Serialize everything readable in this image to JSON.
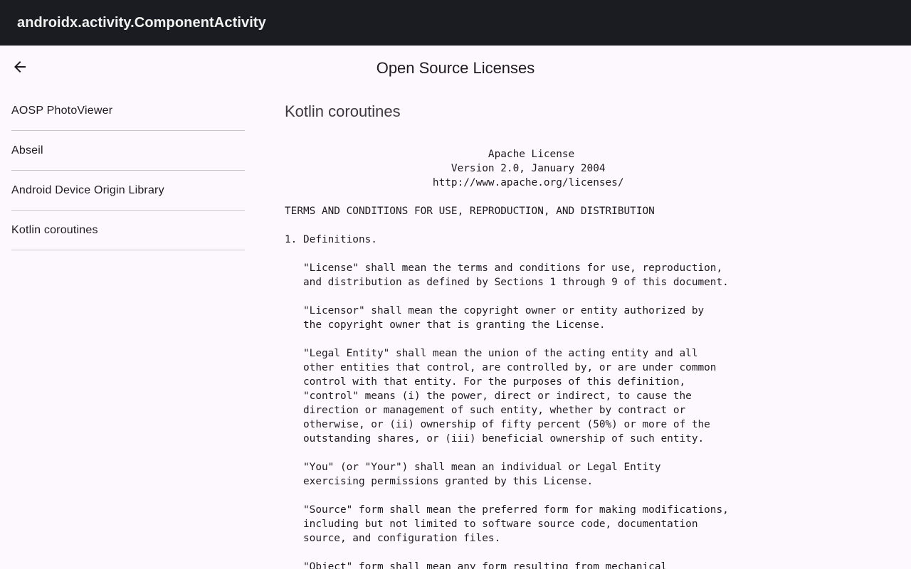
{
  "window": {
    "title": "androidx.activity.ComponentActivity"
  },
  "topbar": {
    "back_icon": "arrow-back-icon",
    "title": "Open Source Licenses"
  },
  "sidebar": {
    "items": [
      {
        "label": "AOSP PhotoViewer"
      },
      {
        "label": "Abseil"
      },
      {
        "label": "Android Device Origin Library"
      },
      {
        "label": "Kotlin coroutines"
      }
    ]
  },
  "content": {
    "title": "Kotlin coroutines",
    "license_text": "                                 Apache License\n                           Version 2.0, January 2004\n                        http://www.apache.org/licenses/\n\nTERMS AND CONDITIONS FOR USE, REPRODUCTION, AND DISTRIBUTION\n\n1. Definitions.\n\n   \"License\" shall mean the terms and conditions for use, reproduction,\n   and distribution as defined by Sections 1 through 9 of this document.\n\n   \"Licensor\" shall mean the copyright owner or entity authorized by\n   the copyright owner that is granting the License.\n\n   \"Legal Entity\" shall mean the union of the acting entity and all\n   other entities that control, are controlled by, or are under common\n   control with that entity. For the purposes of this definition,\n   \"control\" means (i) the power, direct or indirect, to cause the\n   direction or management of such entity, whether by contract or\n   otherwise, or (ii) ownership of fifty percent (50%) or more of the\n   outstanding shares, or (iii) beneficial ownership of such entity.\n\n   \"You\" (or \"Your\") shall mean an individual or Legal Entity\n   exercising permissions granted by this License.\n\n   \"Source\" form shall mean the preferred form for making modifications,\n   including but not limited to software source code, documentation\n   source, and configuration files.\n\n   \"Object\" form shall mean any form resulting from mechanical"
  }
}
